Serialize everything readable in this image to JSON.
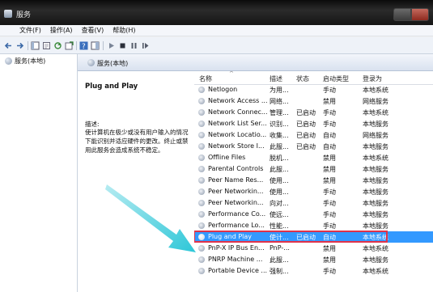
{
  "window": {
    "title": "服务"
  },
  "menu": [
    "文件(F)",
    "操作(A)",
    "查看(V)",
    "帮助(H)"
  ],
  "tree": {
    "root_label": "服务(本地)"
  },
  "pane_header": {
    "label": "服务(本地)"
  },
  "description": {
    "service_name": "Plug and Play",
    "label": "描述:",
    "text": "使计算机在极少或没有用户输入的情况下能识别并适应硬件的更改。终止或禁用此服务会造成系统不稳定。"
  },
  "columns": [
    "名称",
    "描述",
    "状态",
    "启动类型",
    "登录为"
  ],
  "services": [
    {
      "name": "Netlogon",
      "desc": "为用...",
      "status": "",
      "startup": "手动",
      "logon": "本地系统"
    },
    {
      "name": "Network Access ...",
      "desc": "网络...",
      "status": "",
      "startup": "禁用",
      "logon": "网络服务"
    },
    {
      "name": "Network Connec...",
      "desc": "管理...",
      "status": "已启动",
      "startup": "手动",
      "logon": "本地系统"
    },
    {
      "name": "Network List Ser...",
      "desc": "识别...",
      "status": "已启动",
      "startup": "手动",
      "logon": "本地服务"
    },
    {
      "name": "Network Locatio...",
      "desc": "收集...",
      "status": "已启动",
      "startup": "自动",
      "logon": "网络服务"
    },
    {
      "name": "Network Store I...",
      "desc": "此服...",
      "status": "已启动",
      "startup": "自动",
      "logon": "本地服务"
    },
    {
      "name": "Offline Files",
      "desc": "脱机...",
      "status": "",
      "startup": "禁用",
      "logon": "本地系统"
    },
    {
      "name": "Parental Controls",
      "desc": "此服...",
      "status": "",
      "startup": "禁用",
      "logon": "本地服务"
    },
    {
      "name": "Peer Name Res...",
      "desc": "使用...",
      "status": "",
      "startup": "禁用",
      "logon": "本地服务"
    },
    {
      "name": "Peer Networkin...",
      "desc": "使用...",
      "status": "",
      "startup": "手动",
      "logon": "本地服务"
    },
    {
      "name": "Peer Networkin...",
      "desc": "向对...",
      "status": "",
      "startup": "手动",
      "logon": "本地服务"
    },
    {
      "name": "Performance Co...",
      "desc": "使远...",
      "status": "",
      "startup": "手动",
      "logon": "本地服务"
    },
    {
      "name": "Performance Lo...",
      "desc": "性能...",
      "status": "",
      "startup": "手动",
      "logon": "本地服务"
    },
    {
      "name": "Plug and Play",
      "desc": "使计...",
      "status": "已启动",
      "startup": "自动",
      "logon": "本地系统",
      "selected": true
    },
    {
      "name": "PnP-X IP Bus En...",
      "desc": "PnP-...",
      "status": "",
      "startup": "禁用",
      "logon": "本地系统"
    },
    {
      "name": "PNRP Machine ...",
      "desc": "此服...",
      "status": "",
      "startup": "禁用",
      "logon": "本地服务"
    },
    {
      "name": "Portable Device ...",
      "desc": "强制...",
      "status": "",
      "startup": "手动",
      "logon": "本地系统"
    }
  ],
  "colors": {
    "selection": "#3399ff",
    "highlight_box": "#e0334a",
    "arrow": "#2ec7d8"
  }
}
